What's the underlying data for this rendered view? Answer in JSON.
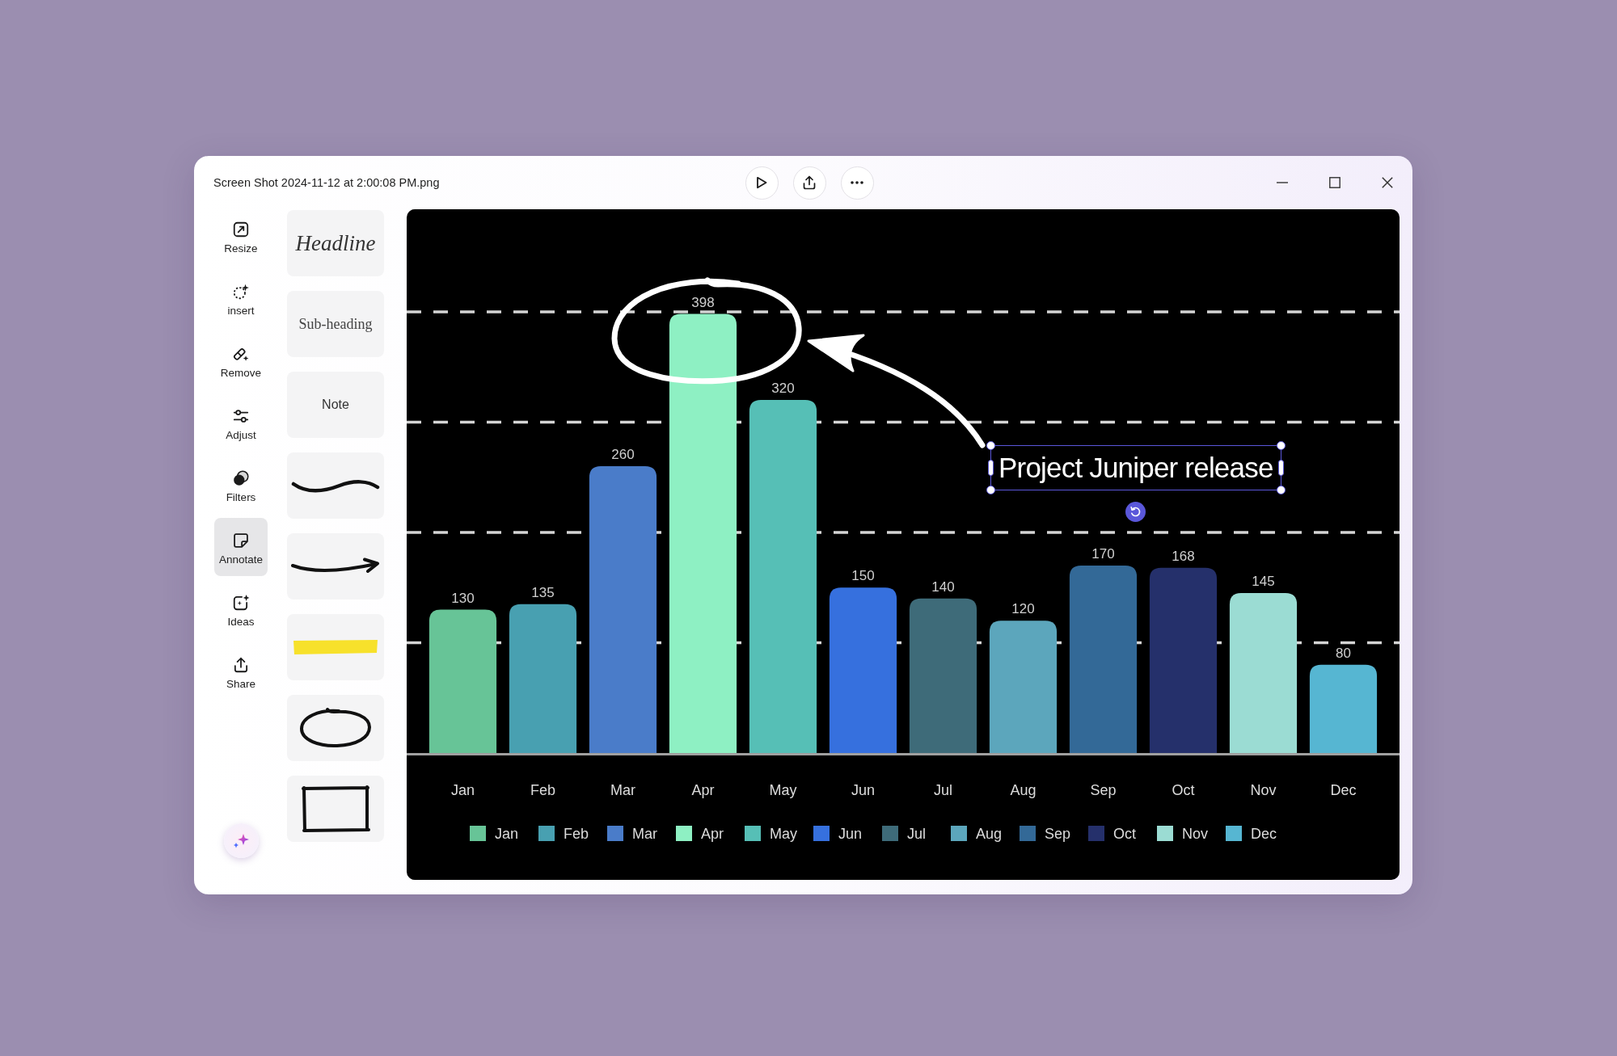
{
  "window": {
    "title": "Screen Shot 2024-11-12 at 2:00:08 PM.png"
  },
  "sidebar": {
    "items": [
      {
        "label": "Resize",
        "selected": false
      },
      {
        "label": "insert",
        "selected": false
      },
      {
        "label": "Remove",
        "selected": false
      },
      {
        "label": "Adjust",
        "selected": false
      },
      {
        "label": "Filters",
        "selected": false
      },
      {
        "label": "Annotate",
        "selected": true
      },
      {
        "label": "Ideas",
        "selected": false
      },
      {
        "label": "Share",
        "selected": false
      }
    ]
  },
  "text_styles": [
    "Headline",
    "Sub-heading",
    "Note"
  ],
  "canvas": {
    "chart_data": {
      "type": "bar",
      "categories": [
        "Jan",
        "Feb",
        "Mar",
        "Apr",
        "May",
        "Jun",
        "Jul",
        "Aug",
        "Sep",
        "Oct",
        "Nov",
        "Dec"
      ],
      "series": [
        {
          "name": "Jan",
          "color": "#67c497",
          "values": [
            130,
            null,
            null,
            null,
            null,
            null,
            null,
            null,
            null,
            null,
            null,
            null
          ]
        },
        {
          "name": "Feb",
          "color": "#48a0b1",
          "values": [
            null,
            135,
            null,
            null,
            null,
            null,
            null,
            null,
            null,
            null,
            null,
            null
          ]
        },
        {
          "name": "Mar",
          "color": "#4a7cc9",
          "values": [
            null,
            null,
            260,
            null,
            null,
            null,
            null,
            null,
            null,
            null,
            null,
            null
          ]
        },
        {
          "name": "Apr",
          "color": "#8ef0c3",
          "values": [
            null,
            null,
            null,
            398,
            null,
            null,
            null,
            null,
            null,
            null,
            null,
            null
          ]
        },
        {
          "name": "May",
          "color": "#56bfb6",
          "values": [
            null,
            null,
            null,
            null,
            320,
            null,
            null,
            null,
            null,
            null,
            null,
            null
          ]
        },
        {
          "name": "Jun",
          "color": "#3670de",
          "values": [
            null,
            null,
            null,
            null,
            null,
            150,
            null,
            null,
            null,
            null,
            null,
            null
          ]
        },
        {
          "name": "Jul",
          "color": "#3e6b79",
          "values": [
            null,
            null,
            null,
            null,
            null,
            null,
            140,
            null,
            null,
            null,
            null,
            null
          ]
        },
        {
          "name": "Aug",
          "color": "#5ca6bc",
          "values": [
            null,
            null,
            null,
            null,
            null,
            null,
            null,
            120,
            null,
            null,
            null,
            null
          ]
        },
        {
          "name": "Sep",
          "color": "#336997",
          "values": [
            null,
            null,
            null,
            null,
            null,
            null,
            null,
            null,
            170,
            null,
            null,
            null
          ]
        },
        {
          "name": "Oct",
          "color": "#25306b",
          "values": [
            null,
            null,
            null,
            null,
            null,
            null,
            null,
            null,
            null,
            168,
            null,
            null
          ]
        },
        {
          "name": "Nov",
          "color": "#9bdcd3",
          "values": [
            null,
            null,
            null,
            null,
            null,
            null,
            null,
            null,
            null,
            null,
            145,
            null
          ]
        },
        {
          "name": "Dec",
          "color": "#56b6d2",
          "values": [
            null,
            null,
            null,
            null,
            null,
            null,
            null,
            null,
            null,
            null,
            null,
            80
          ]
        }
      ],
      "stacked": true,
      "ylim": [
        0,
        490
      ],
      "data_labels": true,
      "legend": "bottom"
    },
    "text_box": {
      "text": "Project Juniper release",
      "selected": true
    }
  }
}
